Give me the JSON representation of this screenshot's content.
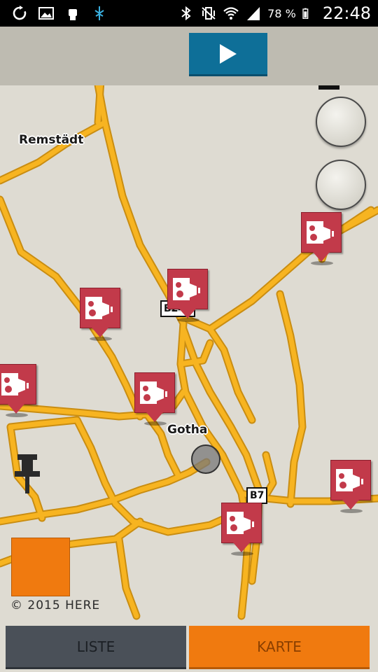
{
  "status_bar": {
    "battery_percent": "78 %",
    "time": "22:48",
    "icons": [
      "sync-icon",
      "image-icon",
      "fist-icon",
      "usb-debug-icon",
      "bluetooth-icon",
      "vibrate-icon",
      "wifi-icon",
      "signal-icon",
      "battery-icon"
    ]
  },
  "toolbar": {
    "play_icon": "play-icon"
  },
  "map": {
    "labels": {
      "remstaedt": "Remstädt",
      "gotha": "Gotha"
    },
    "road_shields": {
      "b247": "B247",
      "b7": "B7"
    },
    "zoom_in_icon": "plus-icon",
    "zoom_out_icon": "minus-icon",
    "speed_camera_count": 7,
    "marker_icon": "speed-camera-icon",
    "colors": {
      "road": "#f7b421",
      "road_edge": "#c98d12",
      "map_bg": "#dedbd2",
      "camera_marker": "#c23a4a",
      "accent": "#f07a0f"
    },
    "copyright": "© 2015 HERE"
  },
  "tabs": {
    "liste": "LISTE",
    "karte": "KARTE",
    "active": "KARTE"
  }
}
